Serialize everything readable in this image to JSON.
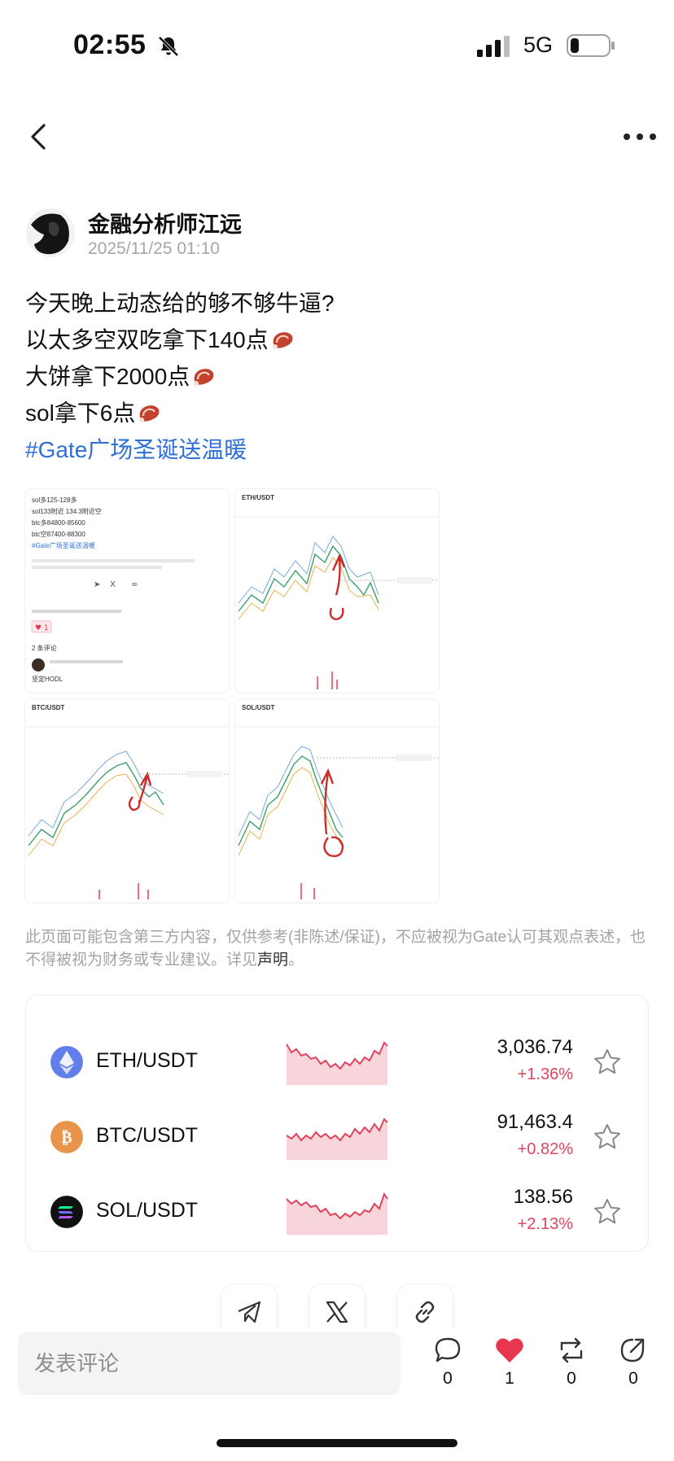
{
  "status_bar": {
    "time": "02:55",
    "network": "5G"
  },
  "author": {
    "name": "金融分析师江远",
    "date": "2025/11/25 01:10"
  },
  "post": {
    "lines": [
      "今天晚上动态给的够不够牛逼?",
      "以太多空双吃拿下140点",
      "大饼拿下2000点",
      "sol拿下6点"
    ],
    "hashtag": "#Gate广场圣诞送温暖"
  },
  "thumbnail_text": {
    "lines": [
      "sol多125-128多",
      "sol133附近 134.3附近空",
      "btc多84800-85600",
      "btc空87400-88300",
      "#Gate广场圣诞送温暖"
    ],
    "comments_header": "2 条评论",
    "comment_text": "坚定HODL",
    "chart_titles": [
      "ETH/USDT",
      "BTC/USDT",
      "SOL/USDT"
    ]
  },
  "disclaimer": {
    "text": "此页面可能包含第三方内容，仅供参考(非陈述/保证)，不应被视为Gate认可其观点表述，也不得被视为财务或专业建议。详见",
    "link": "声明",
    "end": "。"
  },
  "markets": [
    {
      "pair": "ETH/USDT",
      "price": "3,036.74",
      "change": "+1.36%",
      "icon": "ethereum-icon",
      "color": "#627eea"
    },
    {
      "pair": "BTC/USDT",
      "price": "91,463.4",
      "change": "+0.82%",
      "icon": "bitcoin-icon",
      "color": "#e8944a"
    },
    {
      "pair": "SOL/USDT",
      "price": "138.56",
      "change": "+2.13%",
      "icon": "solana-icon",
      "color": "#111111"
    }
  ],
  "comment": {
    "placeholder": "发表评论"
  },
  "actions": {
    "comments": "0",
    "likes": "1",
    "reposts": "0",
    "shares": "0"
  },
  "colors": {
    "accent_link": "#2f6fd8",
    "up": "#e0445c",
    "like": "#e8364f"
  }
}
